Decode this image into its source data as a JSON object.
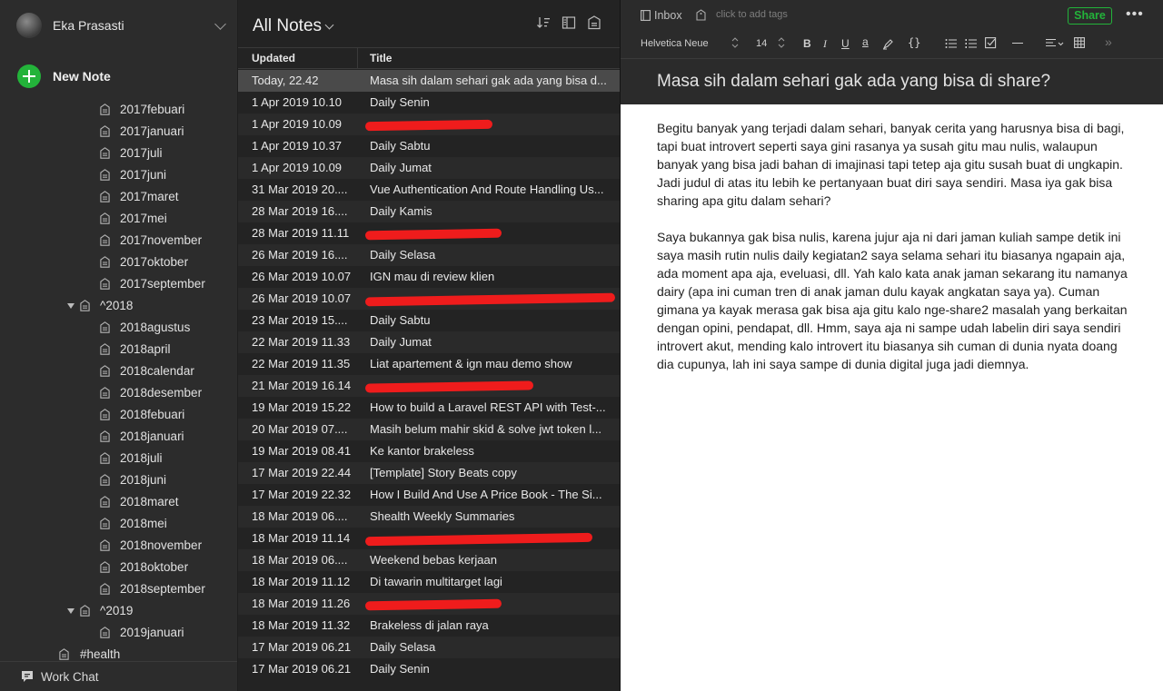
{
  "sidebar": {
    "account_name": "Eka Prasasti",
    "new_note_label": "New Note",
    "tree": [
      {
        "label": "2017febuari",
        "level": 2
      },
      {
        "label": "2017januari",
        "level": 2
      },
      {
        "label": "2017juli",
        "level": 2
      },
      {
        "label": "2017juni",
        "level": 2
      },
      {
        "label": "2017maret",
        "level": 2
      },
      {
        "label": "2017mei",
        "level": 2
      },
      {
        "label": "2017november",
        "level": 2
      },
      {
        "label": "2017oktober",
        "level": 2
      },
      {
        "label": "2017september",
        "level": 2
      },
      {
        "label": "^2018",
        "level": 1,
        "expanded": true
      },
      {
        "label": "2018agustus",
        "level": 2
      },
      {
        "label": "2018april",
        "level": 2
      },
      {
        "label": "2018calendar",
        "level": 2
      },
      {
        "label": "2018desember",
        "level": 2
      },
      {
        "label": "2018febuari",
        "level": 2
      },
      {
        "label": "2018januari",
        "level": 2
      },
      {
        "label": "2018juli",
        "level": 2
      },
      {
        "label": "2018juni",
        "level": 2
      },
      {
        "label": "2018maret",
        "level": 2
      },
      {
        "label": "2018mei",
        "level": 2
      },
      {
        "label": "2018november",
        "level": 2
      },
      {
        "label": "2018oktober",
        "level": 2
      },
      {
        "label": "2018september",
        "level": 2
      },
      {
        "label": "^2019",
        "level": 1,
        "expanded": true
      },
      {
        "label": "2019januari",
        "level": 2
      },
      {
        "label": "#health",
        "level": 0
      }
    ],
    "work_chat_label": "Work Chat"
  },
  "note_list": {
    "title": "All Notes",
    "col_updated": "Updated",
    "col_title": "Title",
    "rows": [
      {
        "date": "Today, 22.42",
        "title": "Masa sih dalam sehari gak ada yang bisa d...",
        "selected": true
      },
      {
        "date": "1 Apr 2019 10.10",
        "title": "Daily Senin"
      },
      {
        "date": "1 Apr 2019 10.09",
        "title": "",
        "redacted": true
      },
      {
        "date": "1 Apr 2019 10.37",
        "title": "Daily Sabtu"
      },
      {
        "date": "1 Apr 2019 10.09",
        "title": "Daily Jumat"
      },
      {
        "date": "31 Mar 2019 20....",
        "title": "Vue Authentication And Route Handling Us..."
      },
      {
        "date": "28 Mar 2019 16....",
        "title": "Daily Kamis"
      },
      {
        "date": "28 Mar 2019 11.11",
        "title": "",
        "redacted": true
      },
      {
        "date": "26 Mar 2019 16....",
        "title": "Daily Selasa"
      },
      {
        "date": "26 Mar 2019 10.07",
        "title": "IGN mau di review klien"
      },
      {
        "date": "26 Mar 2019 10.07",
        "title": "",
        "redacted": true
      },
      {
        "date": "23 Mar 2019 15....",
        "title": "Daily Sabtu"
      },
      {
        "date": "22 Mar 2019 11.33",
        "title": "Daily Jumat"
      },
      {
        "date": "22 Mar 2019 11.35",
        "title": "Liat apartement & ign mau demo show"
      },
      {
        "date": "21 Mar 2019 16.14",
        "title": "",
        "redacted": true
      },
      {
        "date": "19 Mar 2019 15.22",
        "title": "How to build a Laravel REST API with Test-..."
      },
      {
        "date": "20 Mar 2019 07....",
        "title": "Masih belum mahir skid & solve jwt token l..."
      },
      {
        "date": "19 Mar 2019 08.41",
        "title": "Ke kantor brakeless"
      },
      {
        "date": "17 Mar 2019 22.44",
        "title": "[Template] Story Beats copy"
      },
      {
        "date": "17 Mar 2019 22.32",
        "title": "How I Build And Use A Price Book - The Si..."
      },
      {
        "date": "18 Mar 2019 06....",
        "title": "Shealth Weekly Summaries"
      },
      {
        "date": "18 Mar 2019 11.14",
        "title": "",
        "redacted": true
      },
      {
        "date": "18 Mar 2019 06....",
        "title": "Weekend bebas kerjaan"
      },
      {
        "date": "18 Mar 2019 11.12",
        "title": "Di tawarin multitarget lagi"
      },
      {
        "date": "18 Mar 2019 11.26",
        "title": "",
        "redacted": true
      },
      {
        "date": "18 Mar 2019 11.32",
        "title": "Brakeless di jalan raya"
      },
      {
        "date": "17 Mar 2019 06.21",
        "title": "Daily Selasa"
      },
      {
        "date": "17 Mar 2019 06.21",
        "title": "Daily Senin"
      }
    ]
  },
  "editor": {
    "notebook": "Inbox",
    "tags_placeholder": "click to add tags",
    "share_label": "Share",
    "font_name": "Helvetica Neue",
    "font_size": "14",
    "title": "Masa sih dalam sehari gak ada yang bisa di share?",
    "paragraphs": [
      "Begitu banyak yang terjadi dalam sehari, banyak cerita yang harusnya bisa di bagi, tapi buat introvert seperti saya gini rasanya ya susah gitu mau nulis, walaupun banyak yang bisa jadi bahan di imajinasi tapi tetep aja gitu susah buat di ungkapin. Jadi judul di atas itu lebih ke pertanyaan buat diri saya sendiri. Masa iya gak bisa sharing apa gitu dalam sehari?",
      "Saya bukannya gak bisa nulis, karena jujur aja ni dari jaman kuliah sampe detik ini saya masih rutin nulis daily kegiatan2 saya selama sehari itu biasanya ngapain aja, ada moment apa aja, eveluasi, dll. Yah kalo kata anak jaman sekarang itu namanya dairy (apa ini cuman tren di anak jaman dulu kayak angkatan saya ya). Cuman gimana ya kayak merasa gak bisa aja gitu kalo nge-share2 masalah yang berkaitan dengan opini, pendapat, dll. Hmm, saya aja ni sampe udah labelin diri saya sendiri introvert akut, mending kalo introvert itu biasanya sih cuman di dunia nyata doang dia cupunya, lah ini saya sampe di dunia digital juga jadi diemnya."
    ]
  },
  "colors": {
    "accent_green": "#23b33a",
    "redaction": "#ef1c1c"
  }
}
